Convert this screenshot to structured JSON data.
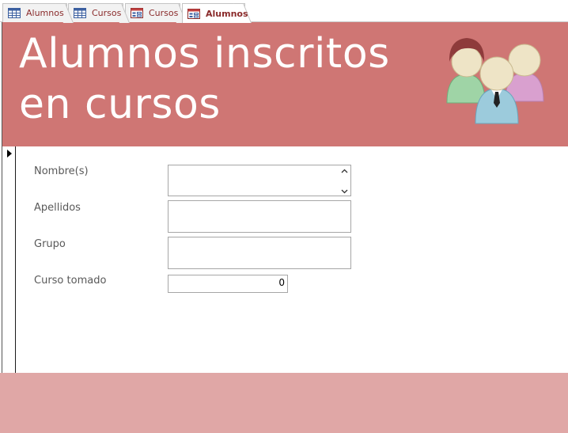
{
  "tabs": [
    {
      "label": "Alumnos",
      "icon": "table-icon",
      "active": false
    },
    {
      "label": "Cursos",
      "icon": "table-icon",
      "active": false
    },
    {
      "label": "Cursos",
      "icon": "form-icon",
      "active": false
    },
    {
      "label": "Alumnos",
      "icon": "form-icon",
      "active": true
    }
  ],
  "header": {
    "title_line1": "Alumnos inscritos",
    "title_line2": "en cursos"
  },
  "fields": {
    "nombres_label": "Nombre(s)",
    "nombres_value": "",
    "apellidos_label": "Apellidos",
    "apellidos_value": "",
    "grupo_label": "Grupo",
    "grupo_value": "",
    "curso_label": "Curso tomado",
    "curso_value": "0"
  },
  "colors": {
    "header_bg": "#cf7674",
    "footer_bg": "#e0a7a6",
    "tab_text": "#8a2b2b",
    "label_text": "#595959"
  }
}
